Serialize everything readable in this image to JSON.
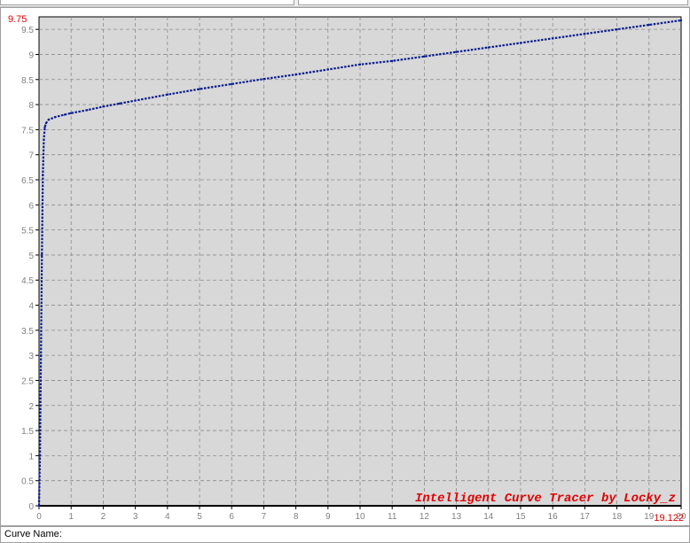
{
  "status_bar": {
    "curve_name_label": "Curve Name:",
    "curve_name_value": ""
  },
  "colors": {
    "plot_background": "#d8d8d8",
    "grid": "#8c8c8c",
    "curve": "#0b1f8f",
    "watermark": "#e00000",
    "corner_labels": "#e00000",
    "axis_tick_labels": "#808080"
  },
  "chart_data": {
    "type": "line",
    "title": "",
    "xlabel": "",
    "ylabel": "",
    "xlim": [
      0,
      20
    ],
    "ylim": [
      0,
      9.75
    ],
    "x_ticks": [
      0,
      1,
      2,
      3,
      4,
      5,
      6,
      7,
      8,
      9,
      10,
      11,
      12,
      13,
      14,
      15,
      16,
      17,
      18,
      19,
      20
    ],
    "x_tick_labels": [
      "0",
      "1",
      "2",
      "3",
      "4",
      "5",
      "6",
      "7",
      "8",
      "9",
      "10",
      "11",
      "12",
      "13",
      "14",
      "15",
      "16",
      "17",
      "18",
      "19",
      "20"
    ],
    "y_ticks": [
      0,
      0.5,
      1,
      1.5,
      2,
      2.5,
      3,
      3.5,
      4,
      4.5,
      5,
      5.5,
      6,
      6.5,
      7,
      7.5,
      8,
      8.5,
      9,
      9.5
    ],
    "y_tick_labels": [
      "0",
      "0.5",
      "1",
      "1.5",
      "2",
      "2.5",
      "3",
      "3.5",
      "4",
      "4.5",
      "5",
      "5.5",
      "6",
      "6.5",
      "7",
      "7.5",
      "8",
      "8.5",
      "9",
      "9.5"
    ],
    "y_max_label": "9.75",
    "x_max_label": "19.122",
    "grid": true,
    "watermark": "Intelligent Curve Tracer by Locky_z",
    "series": [
      {
        "x": [
          0.0,
          0.03,
          0.06,
          0.09,
          0.12,
          0.15,
          0.18,
          0.22,
          0.3,
          0.5,
          0.8,
          1.0,
          1.5,
          2.0,
          2.5,
          3.0,
          4.0,
          5.0,
          6.0,
          7.0,
          8.0,
          9.0,
          10.0,
          11.0,
          12.0,
          13.0,
          14.0,
          15.0,
          16.0,
          17.0,
          18.0,
          19.0,
          20.0
        ],
        "y": [
          0.0,
          1.0,
          3.0,
          5.0,
          6.6,
          7.3,
          7.55,
          7.63,
          7.7,
          7.75,
          7.8,
          7.83,
          7.89,
          7.96,
          8.02,
          8.08,
          8.2,
          8.31,
          8.41,
          8.51,
          8.6,
          8.7,
          8.8,
          8.87,
          8.96,
          9.05,
          9.14,
          9.23,
          9.32,
          9.41,
          9.5,
          9.59,
          9.68
        ]
      }
    ]
  }
}
